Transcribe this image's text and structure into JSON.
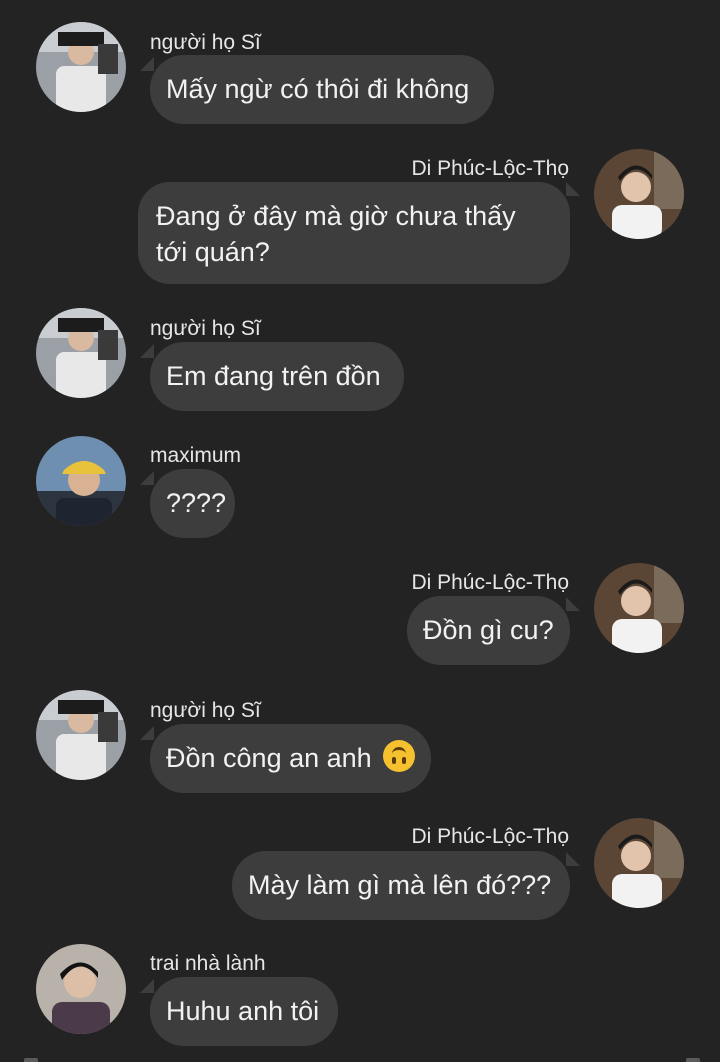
{
  "users": {
    "si": "người họ Sĩ",
    "di": "Di Phúc-Lộc-Thọ",
    "maximum": "maximum",
    "trai": "trai nhà lành"
  },
  "messages": [
    {
      "sender": "người họ Sĩ",
      "text": "Mấy ngừ có thôi đi không"
    },
    {
      "sender": "Di Phúc-Lộc-Thọ",
      "text": "Đang ở đây mà giờ chưa thấy tới quán?"
    },
    {
      "sender": "người họ Sĩ",
      "text": "Em đang trên đồn"
    },
    {
      "sender": "maximum",
      "text": "????"
    },
    {
      "sender": "Di Phúc-Lộc-Thọ",
      "text": "Đồn gì cu?"
    },
    {
      "sender": "người họ Sĩ",
      "text": "Đồn công an anh",
      "emoji": "upside-down-face"
    },
    {
      "sender": "Di Phúc-Lộc-Thọ",
      "text": "Mày làm gì mà lên đó???"
    },
    {
      "sender": "trai nhà lành",
      "text": "Huhu anh tôi"
    }
  ],
  "colors": {
    "background": "#232323",
    "bubble": "#3d3d3d",
    "text": "#f2f2f2"
  }
}
